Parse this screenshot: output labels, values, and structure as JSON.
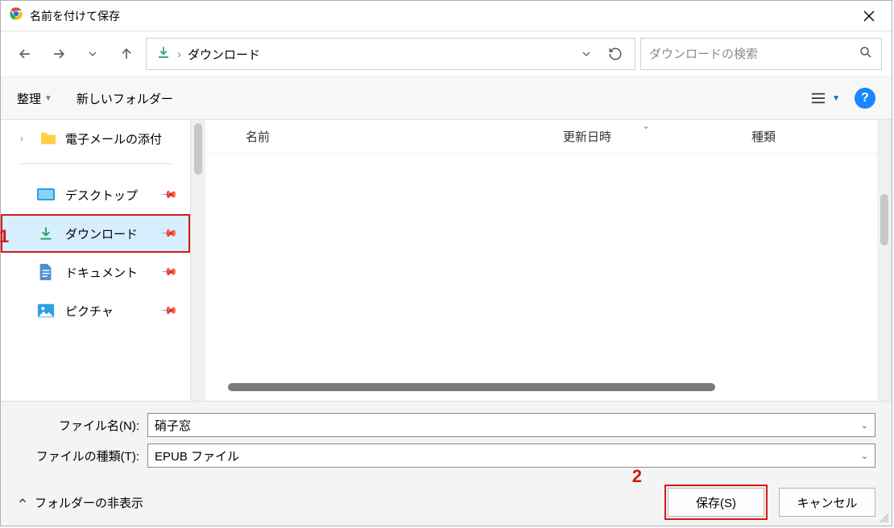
{
  "title": "名前を付けて保存",
  "path": {
    "location": "ダウンロード",
    "sep": "›"
  },
  "search": {
    "placeholder": "ダウンロードの検索"
  },
  "toolbar": {
    "organize": "整理",
    "newfolder": "新しいフォルダー"
  },
  "tree": {
    "email_attach": "電子メールの添付"
  },
  "quick": {
    "desktop": "デスクトップ",
    "downloads": "ダウンロード",
    "documents": "ドキュメント",
    "pictures": "ピクチャ"
  },
  "columns": {
    "name": "名前",
    "date": "更新日時",
    "type": "種類"
  },
  "form": {
    "name_label": "ファイル名(N):",
    "name_value": "硝子窓",
    "type_label": "ファイルの種類(T):",
    "type_value": "EPUB ファイル"
  },
  "footer": {
    "hide": "フォルダーの非表示",
    "save": "保存(S)",
    "cancel": "キャンセル"
  },
  "annotations": {
    "one": "1",
    "two": "2"
  }
}
